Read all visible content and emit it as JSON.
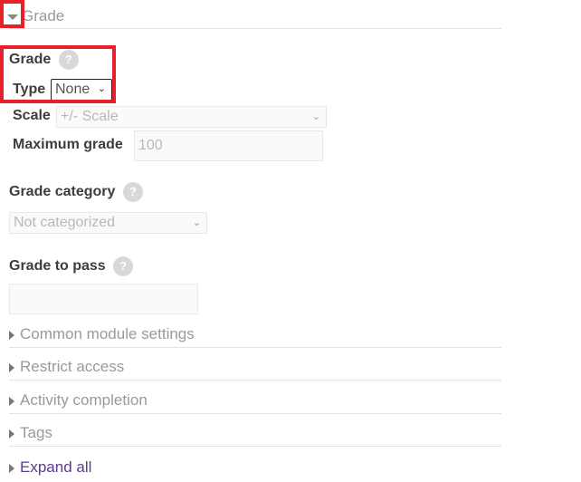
{
  "section": {
    "title": "Grade",
    "expanded": true
  },
  "grade": {
    "label": "Grade",
    "help": "?",
    "type_label": "Type",
    "type_value": "None",
    "scale_label": "Scale",
    "scale_value": "+/- Scale",
    "max_grade_label": "Maximum grade",
    "max_grade_value": "100"
  },
  "grade_category": {
    "label": "Grade category",
    "help": "?",
    "value": "Not categorized"
  },
  "grade_to_pass": {
    "label": "Grade to pass",
    "help": "?",
    "value": ""
  },
  "collapsed_sections": [
    {
      "label": "Common module settings"
    },
    {
      "label": "Restrict access"
    },
    {
      "label": "Activity completion"
    },
    {
      "label": "Tags"
    }
  ],
  "expand_all": "Expand all",
  "highlight_color": "#e8202a"
}
